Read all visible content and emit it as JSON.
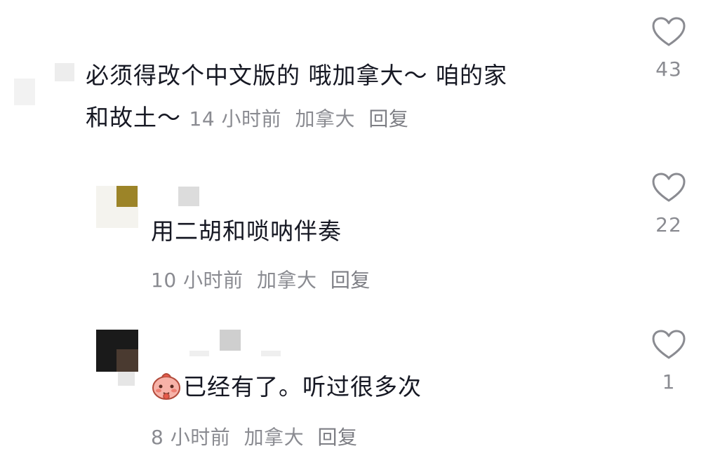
{
  "comments": [
    {
      "text_line1": "必须得改个中文版的 哦加拿大～ 咱的家",
      "text_line2": "和故土～",
      "time": "14 小时前",
      "location": "加拿大",
      "reply_label": "回复",
      "likes": "43"
    },
    {
      "text": "用二胡和唢呐伴奏",
      "time": "10 小时前",
      "location": "加拿大",
      "reply_label": "回复",
      "likes": "22"
    },
    {
      "text": "已经有了。听过很多次",
      "emoji": "blushing-sticker-icon",
      "time": "8 小时前",
      "location": "加拿大",
      "reply_label": "回复",
      "likes": "1"
    }
  ],
  "colors": {
    "text": "#161823",
    "meta": "#8a8b91",
    "heart_stroke": "#8a8b91",
    "background": "#ffffff"
  },
  "icons": {
    "like": "heart-outline-icon"
  }
}
